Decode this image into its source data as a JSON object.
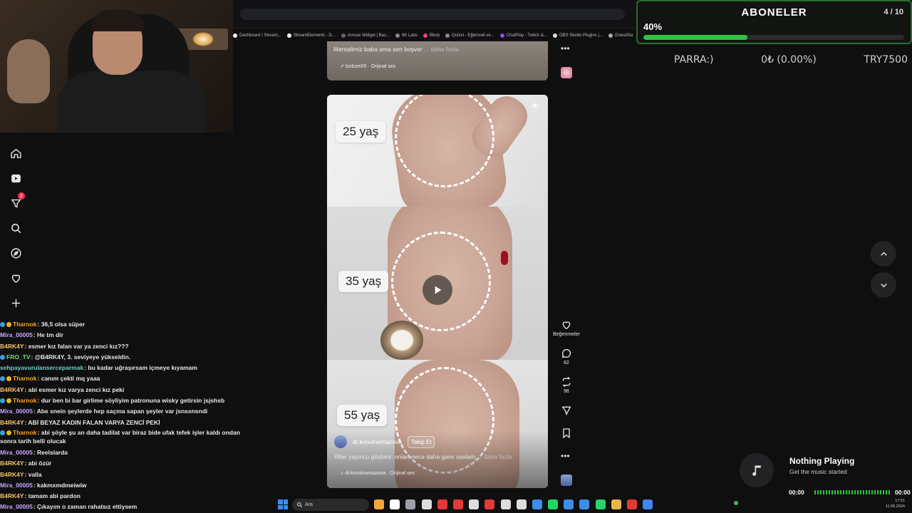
{
  "browser": {
    "bookmarks": [
      {
        "label": "Dashboard / Stream...",
        "color": "#f0f0f0"
      },
      {
        "label": "StreamElements - D...",
        "color": "#ffffff"
      },
      {
        "label": "Amuse Widget | Bas...",
        "color": "#666666"
      },
      {
        "label": "6K Labs",
        "color": "#888888"
      },
      {
        "label": "Blerp",
        "color": "#e24a6e"
      },
      {
        "label": "Quizei - Eğlenceli ve...",
        "color": "#8a8a8a"
      },
      {
        "label": "ChatPlay - Twitch &...",
        "color": "#9147ff"
      },
      {
        "label": "OBS Studio Plugins |...",
        "color": "#dddddd"
      },
      {
        "label": "GravaSta",
        "color": "#aaaaaa"
      }
    ]
  },
  "overlay": {
    "subs_title": "ABONELER",
    "subs_count": "4 / 10",
    "subs_percent": "40%",
    "subs_progress": 0.4,
    "parra_label": "PARRA:)",
    "parra_value": "0₺ (0.00%)",
    "parra_goal": "TRY7500",
    "accent": "#2fc23f"
  },
  "sidebar": {
    "badge_count": "2",
    "items": [
      "home-icon",
      "video-icon",
      "filter-icon",
      "search-icon",
      "explore-icon",
      "heart-icon",
      "plus-icon"
    ]
  },
  "chat": [
    {
      "user": "Tharnok",
      "color": "#f5a623",
      "dots": [
        "b",
        "y"
      ],
      "text": ": 36,5 olsa süper"
    },
    {
      "user": "Mira_00005",
      "color": "#c7a6ff",
      "dots": [],
      "text": ": He tm dir"
    },
    {
      "user": "B4RK4Y",
      "color": "#f5c26b",
      "dots": [],
      "text": ": esmer kız falan var ya zenci kız???"
    },
    {
      "user": "FRO_TV",
      "color": "#6fe36f",
      "dots": [
        "b"
      ],
      "text": ": @B4RK4Y, 3. seviyeye yükseldin."
    },
    {
      "user": "sehpayavurulanserceparmak",
      "color": "#6ad0c8",
      "dots": [],
      "text": ": bu kadar uğraşırsam içmeye kıyamam"
    },
    {
      "user": "Tharnok",
      "color": "#f5a623",
      "dots": [
        "b",
        "y"
      ],
      "text": ": canım çekti mq yaaa"
    },
    {
      "user": "B4RK4Y",
      "color": "#f5c26b",
      "dots": [],
      "text": ": abi esmer kız varya zenci kız peki"
    },
    {
      "user": "Tharnok",
      "color": "#f5a623",
      "dots": [
        "b",
        "y"
      ],
      "text": ": dur ben bi bar girlime söyliyim patronuna wisky getirsin jsjshsb"
    },
    {
      "user": "Mira_00005",
      "color": "#c7a6ff",
      "dots": [],
      "text": ": Abe snein şeylerde hep saçma sapan şeyler var jsnssnsndi"
    },
    {
      "user": "B4RK4Y",
      "color": "#f5c26b",
      "dots": [],
      "text": ": ABİ BEYAZ KADIN FALAN VARYA ZENCİ PEKİ"
    },
    {
      "user": "Tharnok",
      "color": "#f5a623",
      "dots": [
        "b",
        "y"
      ],
      "text": ": abi şöyle şu an daha tadilat var biraz bide ufak tefek işler kaldı ondan sonra tarih belli olucak",
      "wrap": true
    },
    {
      "user": "Mira_00005",
      "color": "#c7a6ff",
      "dots": [],
      "text": ": Reelslarda"
    },
    {
      "user": "B4RK4Y",
      "color": "#f5c26b",
      "dots": [],
      "text": ": abi özür"
    },
    {
      "user": "B4RK4Y",
      "color": "#f5c26b",
      "dots": [],
      "text": ": valla"
    },
    {
      "user": "Mira_00005",
      "color": "#c7a6ff",
      "dots": [],
      "text": ": kakmxmdmeiwiw"
    },
    {
      "user": "B4RK4Y",
      "color": "#f5c26b",
      "dots": [],
      "text": ": tamam abi pardon"
    },
    {
      "user": "Mira_00005",
      "color": "#c7a6ff",
      "dots": [],
      "text": ": Çıkayım o zaman rahatsız ettiysem"
    }
  ],
  "post_top": {
    "caption": "Mentalimiz baba ama sen boşver",
    "more": "... daha fazla",
    "sound": "bizbize05 · Orijinal ses"
  },
  "video": {
    "age1": "25 yaş",
    "age2": "35 yaş",
    "age3": "55 yaş",
    "author": "dr.konulnamazova",
    "follow": "Takip Et",
    "description": "Əllər yaşınızı göstərir: onları necə daha gənc saxlam",
    "more": "... daha fazla",
    "sound": "dr.konulnamazova · Orijinal ses"
  },
  "actions": {
    "like_label": "Beğenmeler",
    "comments": "82",
    "reposts": "96"
  },
  "music": {
    "title": "Nothing Playing",
    "subtitle": "Get the music started",
    "time_start": "00:00",
    "time_end": "00:00"
  },
  "taskbar": {
    "search_placeholder": "Ara",
    "app_colors": [
      "#f4a63a",
      "#ffffff",
      "#9aa0a6",
      "#dddddd",
      "#e53935",
      "#e53935",
      "#dddddd",
      "#e53935",
      "#dddddd",
      "#dddddd",
      "#3b8eea",
      "#1ed760",
      "#3b8eea",
      "#3b8eea",
      "#25d366",
      "#e8b64a",
      "#e53935",
      "#4285f4"
    ],
    "clock": "17:51",
    "date": "11.06.2024"
  }
}
